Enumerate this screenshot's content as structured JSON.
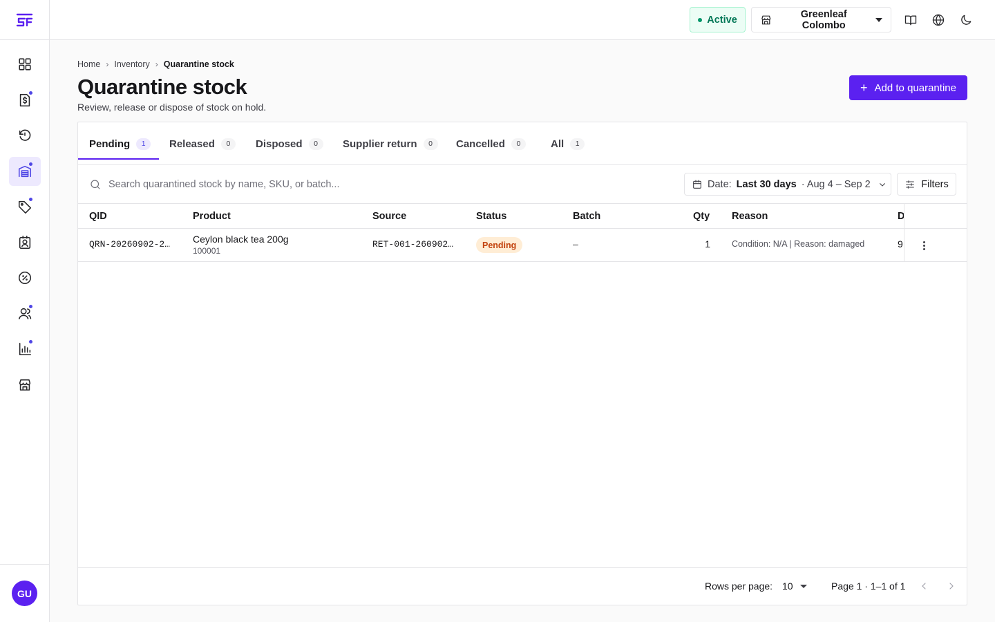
{
  "app": {
    "logo_text": "SF"
  },
  "sidebar": {
    "items": [
      {
        "icon": "dashboard-grid-icon",
        "active": false,
        "dot": false
      },
      {
        "icon": "invoice-dollar-icon",
        "active": false,
        "dot": true
      },
      {
        "icon": "returns-history-icon",
        "active": false,
        "dot": false
      },
      {
        "icon": "warehouse-inventory-icon",
        "active": true,
        "dot": true
      },
      {
        "icon": "tag-icon",
        "active": false,
        "dot": true
      },
      {
        "icon": "contact-badge-icon",
        "active": false,
        "dot": false
      },
      {
        "icon": "discount-badge-icon",
        "active": false,
        "dot": false
      },
      {
        "icon": "users-icon",
        "active": false,
        "dot": true
      },
      {
        "icon": "bar-chart-icon",
        "active": false,
        "dot": true
      },
      {
        "icon": "storefront-icon",
        "active": false,
        "dot": false
      }
    ],
    "user_initials": "GU"
  },
  "header": {
    "status_label": "Active",
    "store_name": "Greenleaf Colombo",
    "icons": [
      "book-icon",
      "globe-icon",
      "moon-icon"
    ]
  },
  "breadcrumb": {
    "items": [
      "Home",
      "Inventory",
      "Quarantine stock"
    ]
  },
  "page": {
    "title": "Quarantine stock",
    "subtitle": "Review, release or dispose of stock on hold.",
    "add_button_label": "Add to quarantine"
  },
  "tabs": [
    {
      "label": "Pending",
      "count": "1",
      "active": true
    },
    {
      "label": "Released",
      "count": "0",
      "active": false
    },
    {
      "label": "Disposed",
      "count": "0",
      "active": false
    },
    {
      "label": "Supplier return",
      "count": "0",
      "active": false
    },
    {
      "label": "Cancelled",
      "count": "0",
      "active": false
    },
    {
      "label": "All",
      "count": "1",
      "active": false
    }
  ],
  "toolbar": {
    "search_placeholder": "Search quarantined stock by name, SKU, or batch...",
    "date_prefix": "Date:",
    "date_range_label": "Last 30 days",
    "date_range_dates": "· Aug 4 – Sep 2",
    "filters_label": "Filters"
  },
  "table": {
    "columns": [
      "QID",
      "Product",
      "Source",
      "Status",
      "Batch",
      "Qty",
      "Reason",
      "D"
    ],
    "rows": [
      {
        "qid": "QRN-20260902-2…",
        "product_name": "Ceylon black tea 200g",
        "product_sku": "100001",
        "source": "RET-001-260902…",
        "status": "Pending",
        "batch": "–",
        "qty": "1",
        "reason": "Condition: N/A | Reason: damaged",
        "date_partial": "9,"
      }
    ]
  },
  "pagination": {
    "rows_per_page_label": "Rows per page:",
    "rows_per_page_value": "10",
    "page_info": "Page 1 · 1–1 of 1"
  },
  "colors": {
    "primary": "#5b21f0",
    "active_green": "#047857",
    "pending_badge_bg": "#ffedd5",
    "pending_badge_text": "#c2410c"
  }
}
